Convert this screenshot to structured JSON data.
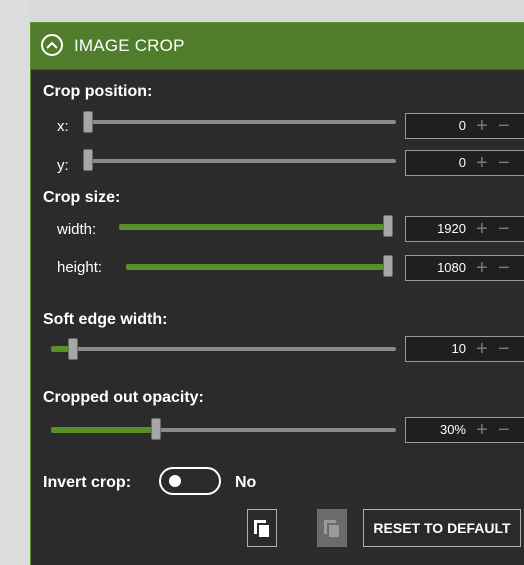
{
  "header": {
    "title": "IMAGE CROP"
  },
  "crop_position": {
    "label": "Crop position:",
    "x": {
      "label": "x:",
      "value": "0"
    },
    "y": {
      "label": "y:",
      "value": "0"
    }
  },
  "crop_size": {
    "label": "Crop size:",
    "width": {
      "label": "width:",
      "value": "1920"
    },
    "height": {
      "label": "height:",
      "value": "1080"
    }
  },
  "soft_edge": {
    "label": "Soft edge width:",
    "value": "10"
  },
  "cropped_opacity": {
    "label": "Cropped out opacity:",
    "value": "30%"
  },
  "invert_crop": {
    "label": "Invert crop:",
    "state": "No"
  },
  "buttons": {
    "copy_icon": "copy-icon",
    "paste_icon": "paste-icon",
    "reset_label": "RESET TO DEFAULT"
  },
  "stepper": {
    "plus": "+",
    "minus": "−"
  },
  "colors": {
    "accent": "#5a8f2a",
    "header": "#4f7d2b",
    "panel": "#2b2b2b"
  }
}
